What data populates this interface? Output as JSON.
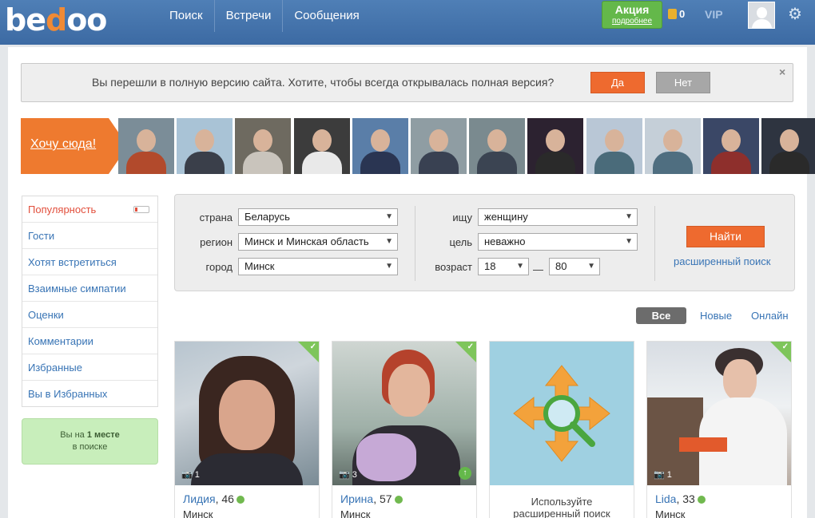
{
  "header": {
    "logo": "bedoo",
    "nav": [
      "Поиск",
      "Встречи",
      "Сообщения"
    ],
    "promo_title": "Акция",
    "promo_link": "подробнее",
    "coins": "0",
    "vip": "VIP",
    "colors": {
      "bar": "#4a78b0",
      "accent": "#f08a35",
      "promo": "#64b84a"
    }
  },
  "notice": {
    "message": "Вы перешли в полную версию сайта. Хотите, чтобы всегда открывалась полная версия?",
    "yes": "Да",
    "no": "Нет",
    "close": "×"
  },
  "strip": {
    "cta": "Хочу сюда!",
    "thumb_count": 12
  },
  "sidebar": {
    "items": [
      {
        "label": "Популярность",
        "active": true
      },
      {
        "label": "Гости"
      },
      {
        "label": "Хотят встретиться"
      },
      {
        "label": "Взаимные симпатии"
      },
      {
        "label": "Оценки"
      },
      {
        "label": "Комментарии"
      },
      {
        "label": "Избранные"
      },
      {
        "label": "Вы в Избранных"
      }
    ],
    "rank_prefix": "Вы на",
    "rank_value": "1 месте",
    "rank_suffix": "в поиске"
  },
  "search": {
    "country_label": "страна",
    "country": "Беларусь",
    "region_label": "регион",
    "region": "Минск и Минская область",
    "city_label": "город",
    "city": "Минск",
    "seek_label": "ищу",
    "seek": "женщину",
    "goal_label": "цель",
    "goal": "неважно",
    "age_label": "возраст",
    "age_from": "18",
    "age_to": "80",
    "age_dash": "—",
    "find": "Найти",
    "advanced": "расширенный поиск"
  },
  "filters": {
    "all": "Все",
    "new": "Новые",
    "online": "Онлайн"
  },
  "cards": [
    {
      "name": "Лидия",
      "age": ", 46",
      "city": "Минск",
      "photos": "1"
    },
    {
      "name": "Ирина",
      "age": ", 57",
      "city": "Минск",
      "photos": "3"
    },
    {
      "advanced_line1": "Используйте",
      "advanced_line2": "расширенный поиск"
    },
    {
      "name": "Lida",
      "age": ", 33",
      "city": "Минск",
      "photos": "1"
    }
  ]
}
